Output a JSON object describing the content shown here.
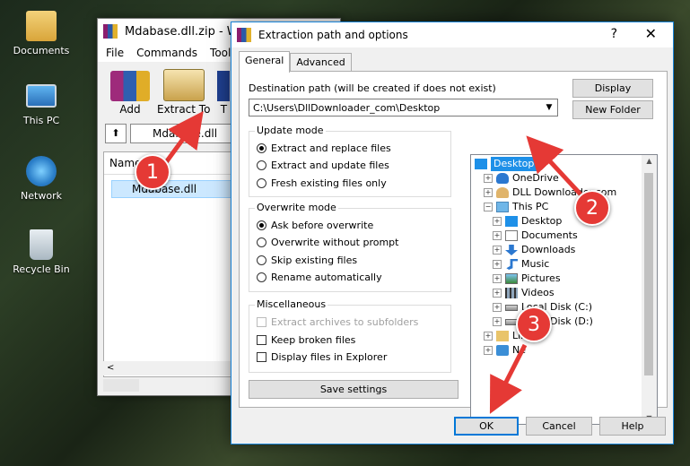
{
  "desktop": {
    "icons": [
      "Documents",
      "This PC",
      "Network",
      "Recycle Bin"
    ]
  },
  "winrar": {
    "title": "Mdabase.dll.zip - W",
    "menu": [
      "File",
      "Commands",
      "Tools"
    ],
    "toolbar": {
      "add": "Add",
      "extract": "Extract To",
      "next": "T"
    },
    "address": "Mdabase.dll",
    "list_header": "Name",
    "files": [
      "Mdabase.dll"
    ],
    "scroll_left": "<"
  },
  "dialog": {
    "title": "Extraction path and options",
    "help_btn": "?",
    "close_btn": "✕",
    "tabs": [
      "General",
      "Advanced"
    ],
    "destination_label": "Destination path (will be created if does not exist)",
    "destination_value": "C:\\Users\\DllDownloader_com\\Desktop",
    "display_btn": "Display",
    "new_folder_btn": "New Folder",
    "update_mode": {
      "title": "Update mode",
      "options": [
        "Extract and replace files",
        "Extract and update files",
        "Fresh existing files only"
      ],
      "selected": 0
    },
    "overwrite_mode": {
      "title": "Overwrite mode",
      "options": [
        "Ask before overwrite",
        "Overwrite without prompt",
        "Skip existing files",
        "Rename automatically"
      ],
      "selected": 0
    },
    "misc": {
      "title": "Miscellaneous",
      "options": [
        "Extract archives to subfolders",
        "Keep broken files",
        "Display files in Explorer"
      ]
    },
    "save_settings_btn": "Save settings",
    "tree": [
      {
        "label": "Desktop",
        "level": 0,
        "icon": "desktop-icon",
        "selected": true
      },
      {
        "label": "OneDrive",
        "level": 1,
        "icon": "cloud-icon"
      },
      {
        "label": "DLL Downloader.com",
        "level": 1,
        "icon": "user-icon"
      },
      {
        "label": "This PC",
        "level": 1,
        "icon": "pc-icon",
        "expanded": true
      },
      {
        "label": "Desktop",
        "level": 2,
        "icon": "desktop-icon"
      },
      {
        "label": "Documents",
        "level": 2,
        "icon": "document-icon"
      },
      {
        "label": "Downloads",
        "level": 2,
        "icon": "download-icon"
      },
      {
        "label": "Music",
        "level": 2,
        "icon": "music-icon"
      },
      {
        "label": "Pictures",
        "level": 2,
        "icon": "picture-icon"
      },
      {
        "label": "Videos",
        "level": 2,
        "icon": "video-icon"
      },
      {
        "label": "Local Disk (C:)",
        "level": 2,
        "icon": "disk-icon"
      },
      {
        "label": "Local Disk (D:)",
        "level": 2,
        "icon": "disk-icon"
      },
      {
        "label": "Libr",
        "level": 1,
        "icon": "library-icon"
      },
      {
        "label": "Ne",
        "level": 1,
        "icon": "network-icon"
      }
    ],
    "ok_btn": "OK",
    "cancel_btn": "Cancel",
    "help_footer_btn": "Help"
  },
  "annotations": {
    "markers": [
      "1",
      "2",
      "3"
    ],
    "color": "#e53935"
  }
}
